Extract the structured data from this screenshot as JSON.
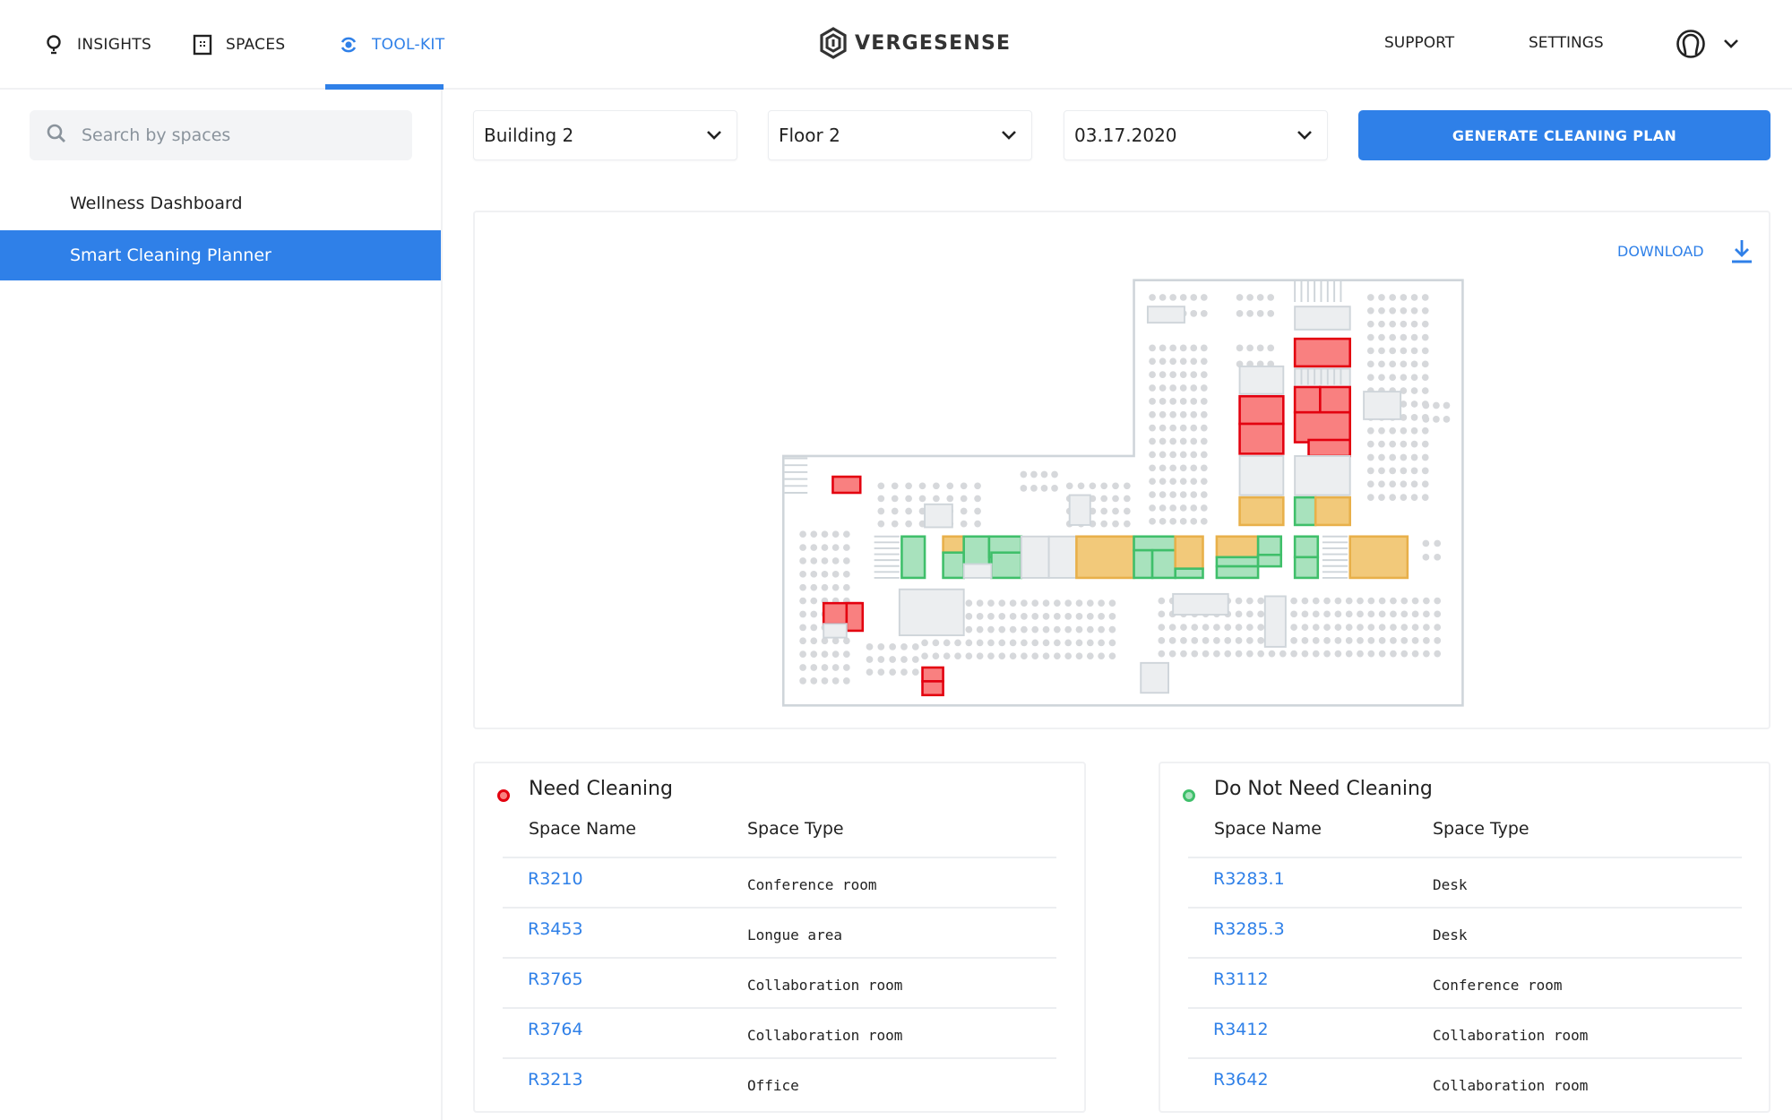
{
  "header": {
    "nav": [
      {
        "label": "INSIGHTS",
        "icon": "lightbulb-icon",
        "active": false
      },
      {
        "label": "SPACES",
        "icon": "building-icon",
        "active": false
      },
      {
        "label": "TOOL-KIT",
        "icon": "toolkit-icon",
        "active": true
      }
    ],
    "logo_text": "VERGESENSE",
    "support_label": "SUPPORT",
    "settings_label": "SETTINGS",
    "user_icon": "user-avatar-icon",
    "user_menu_icon": "chevron-down-icon"
  },
  "sidebar": {
    "search_placeholder": "Search by spaces",
    "search_value": "",
    "items": [
      {
        "label": "Wellness Dashboard",
        "active": false
      },
      {
        "label": "Smart Cleaning Planner",
        "active": true
      }
    ]
  },
  "controls": {
    "building": "Building 2",
    "floor": "Floor 2",
    "date": "03.17.2020",
    "generate_label": "GENERATE CLEANING PLAN"
  },
  "map": {
    "download_label": "DOWNLOAD",
    "legend_colors": {
      "need_cleaning": "#e3000f",
      "partial": "#e8b04a",
      "clean": "#3fbf6a",
      "neutral": "#cfd5da"
    }
  },
  "need_cleaning": {
    "title": "Need Cleaning",
    "dot_color": "#e3000f",
    "columns": [
      "Space Name",
      "Space Type"
    ],
    "rows": [
      {
        "name": "R3210",
        "type": "Conference room"
      },
      {
        "name": "R3453",
        "type": "Longue area"
      },
      {
        "name": "R3765",
        "type": "Collaboration room"
      },
      {
        "name": "R3764",
        "type": "Collaboration room"
      },
      {
        "name": "R3213",
        "type": "Office"
      }
    ]
  },
  "no_cleaning": {
    "title": "Do Not Need Cleaning",
    "dot_color": "#3fbf6a",
    "columns": [
      "Space Name",
      "Space Type"
    ],
    "rows": [
      {
        "name": "R3283.1",
        "type": "Desk"
      },
      {
        "name": "R3285.3",
        "type": "Desk"
      },
      {
        "name": "R3112",
        "type": "Conference room"
      },
      {
        "name": "R3412",
        "type": "Collaboration room"
      },
      {
        "name": "R3642",
        "type": "Collaboration room"
      }
    ]
  }
}
